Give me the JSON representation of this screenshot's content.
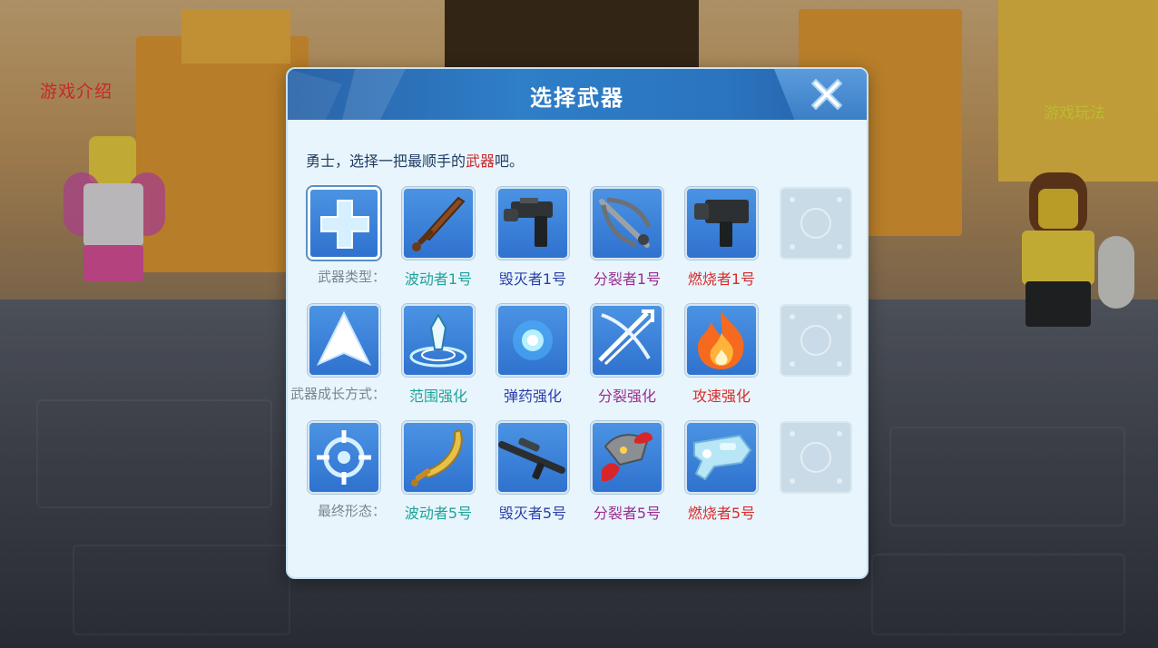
{
  "scene": {
    "left_text": "游戏介绍",
    "right_text": "游戏玩法"
  },
  "dialog": {
    "title": "选择武器",
    "intro_prefix": "勇士，选择一把最顺手的",
    "intro_highlight": "武器",
    "intro_suffix": "吧。",
    "rows": [
      {
        "label": "武器类型：",
        "type_icon": "plus-icon",
        "items": [
          {
            "name": "波动者1号",
            "icon": "sword-icon",
            "color": "#1fa29b"
          },
          {
            "name": "毁灭者1号",
            "icon": "blaster-pistol-icon",
            "color": "#2b3fa8"
          },
          {
            "name": "分裂者1号",
            "icon": "crossbow-icon",
            "color": "#9a2d8f"
          },
          {
            "name": "燃烧者1号",
            "icon": "heavy-pistol-icon",
            "color": "#d92b2b"
          }
        ]
      },
      {
        "label": "武器成长方式：",
        "type_icon": "arrow-up-icon",
        "items": [
          {
            "name": "范围强化",
            "icon": "range-crystal-icon",
            "color": "#1fa29b"
          },
          {
            "name": "弹药强化",
            "icon": "energy-orb-icon",
            "color": "#2b3fa8"
          },
          {
            "name": "分裂强化",
            "icon": "split-arrows-icon",
            "color": "#9a2d8f"
          },
          {
            "name": "攻速强化",
            "icon": "fire-icon",
            "color": "#d92b2b"
          }
        ]
      },
      {
        "label": "最终形态：",
        "type_icon": "crosshair-icon",
        "items": [
          {
            "name": "波动者5号",
            "icon": "golden-saber-icon",
            "color": "#1fa29b"
          },
          {
            "name": "毁灭者5号",
            "icon": "sniper-rifle-icon",
            "color": "#2b3fa8"
          },
          {
            "name": "分裂者5号",
            "icon": "dragon-crossbow-icon",
            "color": "#9a2d8f"
          },
          {
            "name": "燃烧者5号",
            "icon": "ice-cannon-icon",
            "color": "#d92b2b"
          }
        ]
      }
    ]
  }
}
